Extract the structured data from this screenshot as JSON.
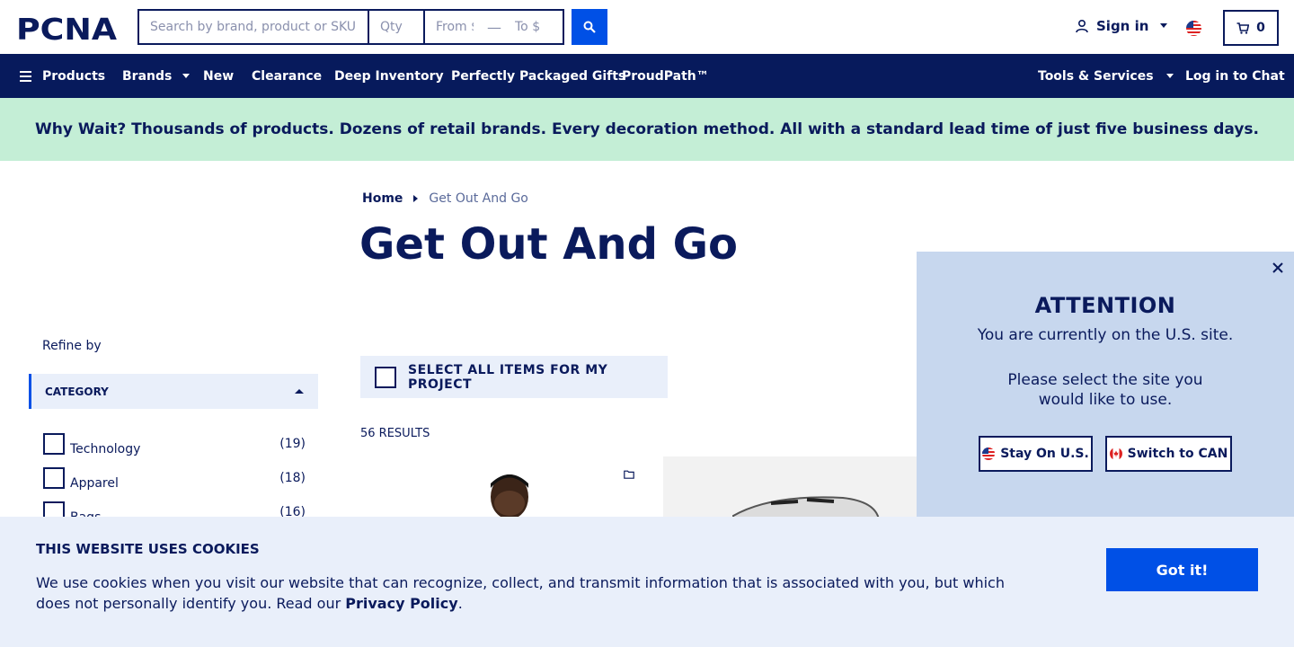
{
  "header": {
    "logo_text": "PCNA",
    "search_placeholder": "Search by brand, product or SKU",
    "qty_placeholder": "Qty",
    "from_placeholder": "From $",
    "to_placeholder": "To $",
    "sign_in_label": "Sign in",
    "cart_count": "0"
  },
  "nav": {
    "products": "Products",
    "brands": "Brands",
    "new": "New",
    "clearance": "Clearance",
    "deep_inventory": "Deep Inventory",
    "gifts": "Perfectly Packaged Gifts",
    "proudpath": "ProudPath™",
    "tools": "Tools & Services",
    "chat": "Log in to Chat"
  },
  "promo": {
    "text": "Why Wait? Thousands of products. Dozens of retail brands. Every decoration method. All with a standard lead time of just five business days."
  },
  "breadcrumb": {
    "home": "Home",
    "current": "Get Out And Go"
  },
  "page_title": "Get Out And Go",
  "sidebar": {
    "refine_label": "Refine by",
    "category_heading": "CATEGORY",
    "categories": [
      {
        "label": "Technology",
        "count": "(19)"
      },
      {
        "label": "Apparel",
        "count": "(18)"
      },
      {
        "label": "Bags",
        "count": "(16)"
      }
    ]
  },
  "listing": {
    "select_all_label": "SELECT ALL ITEMS FOR MY PROJECT",
    "results_label": "56 RESULTS"
  },
  "attention_modal": {
    "heading": "ATTENTION",
    "line1": "You are currently on the U.S. site.",
    "line2": "Please select the site you would like to use.",
    "stay_button": "Stay On U.S.",
    "switch_button": "Switch to CAN"
  },
  "cookie_banner": {
    "title": "THIS WEBSITE USES COOKIES",
    "text": "We use cookies when you visit our website that can recognize, collect, and transmit information that is associated with you, but which does not personally identify you. Read our ",
    "link_text": "Privacy Policy",
    "text_end": ".",
    "button": "Got it!"
  },
  "colors": {
    "navy": "#0a1a5c",
    "nav_bg": "#071a5c",
    "accent_blue": "#0050e6",
    "promo_bg": "#c4eed6",
    "panel_bg": "#e9effa",
    "modal_bg": "#c7d7ee"
  },
  "icons": [
    "search-icon",
    "user-icon",
    "chevron-down-icon",
    "us-flag-icon",
    "cart-icon",
    "hamburger-icon",
    "close-icon",
    "canada-flag-icon",
    "folder-icon"
  ]
}
